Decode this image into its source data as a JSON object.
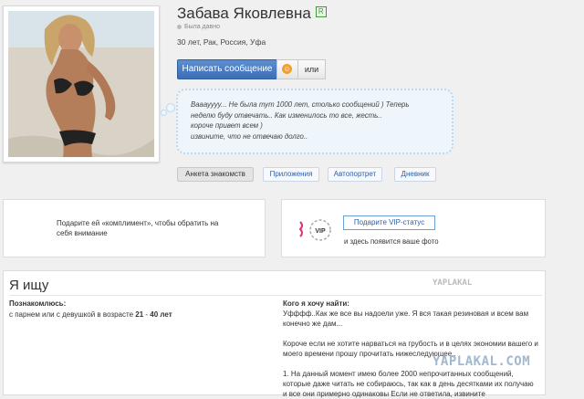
{
  "profile": {
    "name": "Забава Яковлевна",
    "verified_mark": "R",
    "online_status": "Была давно",
    "meta": "30 лет, Рак, Россия, Уфа",
    "photo_icon": "profile-photo"
  },
  "actions": {
    "message_label": "Написать сообщение",
    "gift_icon": "smiley-icon",
    "or_label": "или"
  },
  "status": {
    "lines": [
      "Вааауууу... Не была тут 1000 лет, столько сообщений ) Теперь",
      "неделю буду отвечать.. Как изменилось то все, жесть..",
      "короче привет всем )",
      "извините, что не отвечаю долго.."
    ]
  },
  "tabs": [
    {
      "label": "Анкета знакомств",
      "active": true
    },
    {
      "label": "Приложения",
      "active": false
    },
    {
      "label": "Автопортрет",
      "active": false
    },
    {
      "label": "Дневник",
      "active": false
    }
  ],
  "compliment": {
    "text": "Подарите ей «комплимент», чтобы обратить на себя внимание"
  },
  "vip": {
    "badge": "VIP",
    "button_label": "Подарите VIP-статус",
    "text": "и здесь появится ваше фото",
    "accent_color": "#e0307a"
  },
  "search": {
    "title": "Я ищу",
    "left_heading": "Познакомлюсь:",
    "left_text_prefix": "с парнем или с девушкой в возрасте ",
    "age_from": "21",
    "age_sep": " - ",
    "age_to": "40 лет",
    "right_heading": "Кого я хочу найти:",
    "right_p1": "Уфффф..Как же все вы надоели уже. Я вся такая резиновая и всем вам конечно же дам...",
    "right_p2": "Короче если не хотите нарваться на грубость и в целях экономии вашего и моего времени прошу прочитать нижеследующее..",
    "right_p3": "1. На данный момент имею более 2000 непрочитанных сообщений, которые даже читать не собираюсь, так как в день десятками их получаю и все они примерно одинаковы Если не ответила, извините"
  },
  "watermark": {
    "text": "YAPLAKAL.COM",
    "small": "YAPLAKAL"
  }
}
